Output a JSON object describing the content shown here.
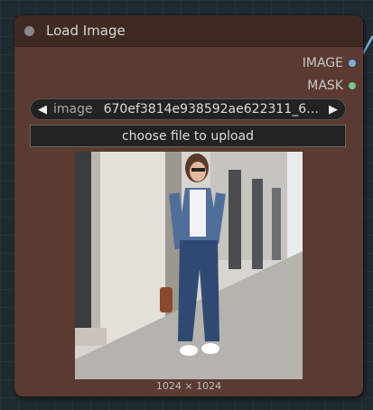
{
  "node": {
    "title": "Load Image",
    "outputs": [
      {
        "label": "IMAGE",
        "color": "#7ab0e0"
      },
      {
        "label": "MASK",
        "color": "#7dc48a"
      }
    ],
    "combo": {
      "name": "image",
      "value": "670ef3814e938592ae622311_66…"
    },
    "upload_label": "choose file to upload",
    "preview_size": "1024 × 1024"
  },
  "preview_image": {
    "subject": "woman in denim jacket, white t-shirt and jeans with white sneakers and brown handbag on city sidewalk"
  }
}
